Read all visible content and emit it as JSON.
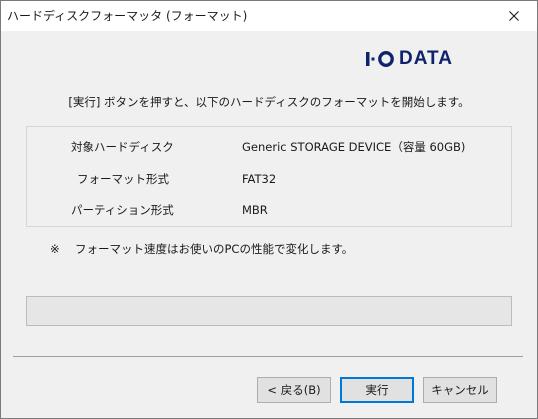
{
  "window": {
    "title": "ハードディスクフォーマッタ (フォーマット)",
    "close_icon": "close-icon"
  },
  "brand": {
    "logo_text": "I·O DATA",
    "logo_word": "DATA",
    "color": "#10226b"
  },
  "instruction": "[実行] ボタンを押すと、以下のハードディスクのフォーマットを開始します。",
  "info": [
    {
      "label": "対象ハードディスク",
      "value": "Generic STORAGE DEVICE（容量 60GB)"
    },
    {
      "label": "フォーマット形式",
      "value": "FAT32"
    },
    {
      "label": "パーティション形式",
      "value": "MBR"
    }
  ],
  "note": {
    "mark": "※",
    "text": "フォーマット速度はお使いのPCの性能で変化します。"
  },
  "progress": {
    "value": 0,
    "fill_color": "#06b025"
  },
  "buttons": {
    "back": "< 戻る(B)",
    "run": "実行",
    "cancel": "キャンセル"
  }
}
